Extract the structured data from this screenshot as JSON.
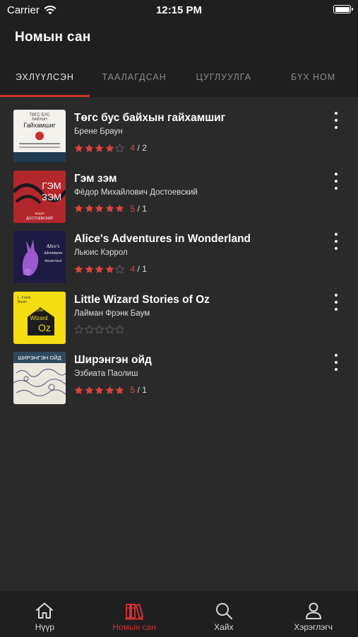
{
  "status": {
    "carrier": "Carrier",
    "time": "12:15 PM",
    "battery_level": 1.0
  },
  "header": {
    "title": "Номын сан"
  },
  "tabs": [
    {
      "label": "ЭХЛҮҮЛСЭН",
      "active": true
    },
    {
      "label": "ТААЛАГДСАН",
      "active": false
    },
    {
      "label": "ЦУГЛУУЛГА",
      "active": false
    },
    {
      "label": "БҮХ НОМ",
      "active": false
    }
  ],
  "books": [
    {
      "title": "Төгс бус байхын гайхамшиг",
      "author": "Брене Браун",
      "stars": 4,
      "score": "4",
      "count": "/ 2",
      "cover_text": [
        "ТӨГС БУС",
        "БАЙХЫН",
        "Гайхамшиг"
      ]
    },
    {
      "title": "Гэм зэм",
      "author": "Фёдор Михайлович Достоевский",
      "stars": 5,
      "score": "5",
      "count": "/ 1",
      "cover_text": [
        "ГЭМ",
        "ЗЭМ",
        "ФЁДОР",
        "ДОСТОЕВСКИЙ"
      ]
    },
    {
      "title": "Alice's Adventures in Wonderland",
      "author": "Льюис Кэррол",
      "stars": 4,
      "score": "4",
      "count": "/ 1",
      "cover_text": [
        "Alice's",
        "Adventures",
        "Wonderland"
      ]
    },
    {
      "title": "Little Wizard Stories of Oz",
      "author": "Лайман Фрэнк Баум",
      "stars": 0,
      "score": "",
      "count": "",
      "cover_text": [
        "L. Frank",
        "Baum",
        "Little",
        "Wizard",
        "Oz"
      ]
    },
    {
      "title": "Ширэнгэн ойд",
      "author": "Эзбиата Паолиш",
      "stars": 5,
      "score": "5",
      "count": "/ 1",
      "cover_text": [
        "ШИРЭНГЭН ОЙД"
      ]
    }
  ],
  "nav": [
    {
      "label": "Нүүр",
      "icon": "home-icon",
      "active": false
    },
    {
      "label": "Номын сан",
      "icon": "library-icon",
      "active": true
    },
    {
      "label": "Хайх",
      "icon": "search-icon",
      "active": false
    },
    {
      "label": "Хэрэглэгч",
      "icon": "user-icon",
      "active": false
    }
  ],
  "colors": {
    "accent": "#d0312d",
    "star_filled": "#e0413b",
    "star_empty": "#5a5a5c",
    "background": "#2a2a2b",
    "bar": "#1f1f20"
  }
}
